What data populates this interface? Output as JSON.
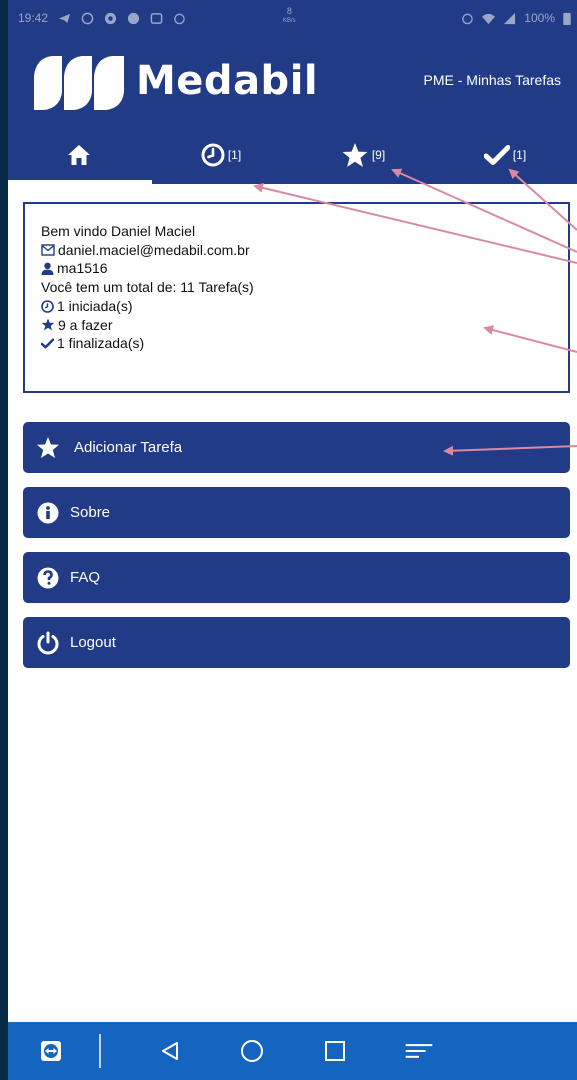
{
  "status_bar": {
    "time": "19:42",
    "net_speed_value": "8",
    "net_speed_unit": "KB/s",
    "battery": "100%"
  },
  "header": {
    "brand": "Medabil",
    "app_title": "PME - Minhas Tarefas"
  },
  "tabs": [
    {
      "icon": "home-icon",
      "badge": ""
    },
    {
      "icon": "clock-icon",
      "badge": "[1]"
    },
    {
      "icon": "star-icon",
      "badge": "[9]"
    },
    {
      "icon": "check-icon",
      "badge": "[1]"
    }
  ],
  "welcome": {
    "greeting": "Bem vindo Daniel Maciel",
    "email": "daniel.maciel@medabil.com.br",
    "username": "ma1516",
    "total": "Você tem um total de: 11 Tarefa(s)",
    "started": "1 iniciada(s)",
    "todo": "9 a fazer",
    "finished": "1 finalizada(s)"
  },
  "menu": [
    {
      "label": "Adicionar Tarefa",
      "icon": "star-icon"
    },
    {
      "label": "Sobre",
      "icon": "info-icon"
    },
    {
      "label": "FAQ",
      "icon": "question-icon"
    },
    {
      "label": "Logout",
      "icon": "power-icon"
    }
  ],
  "colors": {
    "primary": "#223b86",
    "nav_bar": "#1565c0",
    "annotation_arrow": "#d98aa2",
    "outer_background": "#062a45"
  }
}
